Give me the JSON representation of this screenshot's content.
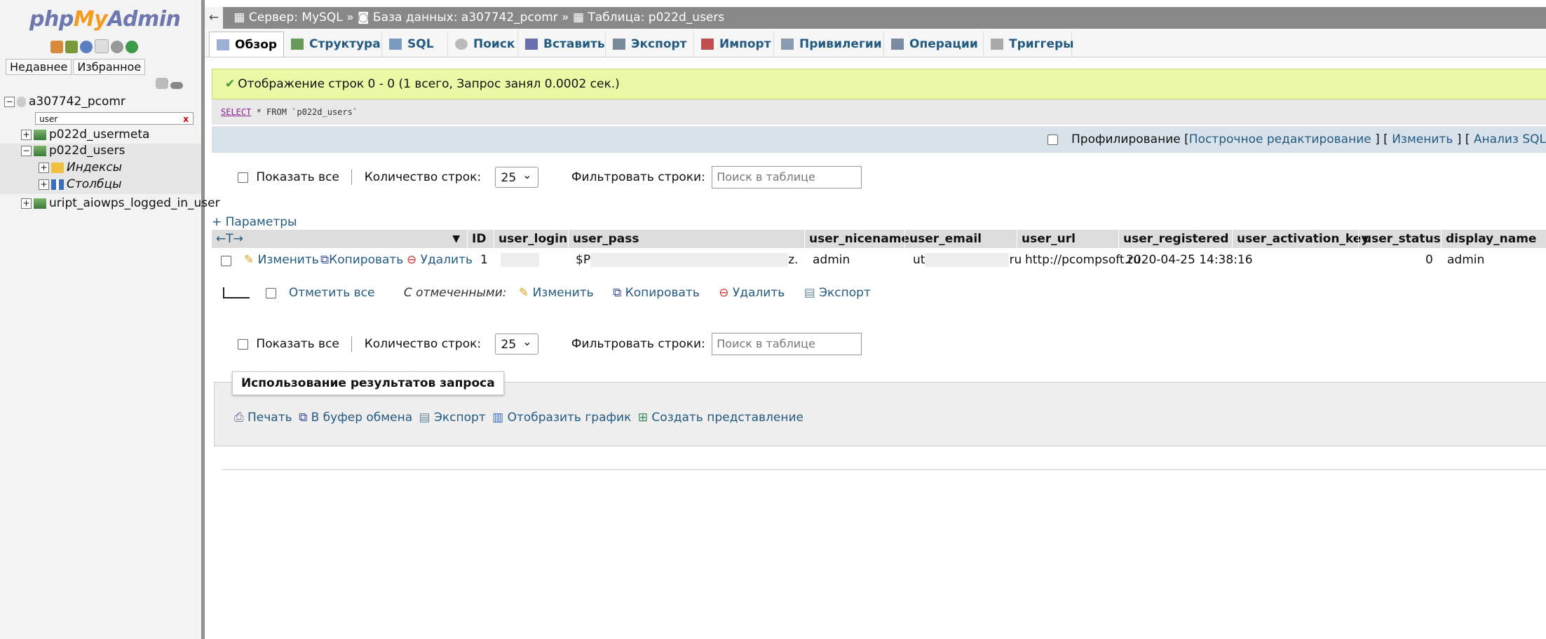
{
  "sidebar": {
    "logo_php": "php",
    "logo_my": "My",
    "logo_admin": "Admin",
    "tabs": [
      "Недавнее",
      "Избранное"
    ],
    "database": "a307742_pcomr",
    "filter_value": "user",
    "filter_clear": "x",
    "tables": [
      {
        "name": "p022d_usermeta"
      },
      {
        "name": "p022d_users"
      },
      {
        "name": "Индексы"
      },
      {
        "name": "Столбцы"
      },
      {
        "name": "uript_aiowps_logged_in_user"
      }
    ]
  },
  "breadcrumb": {
    "back": "←",
    "server": "Сервер: MySQL",
    "sep": "»",
    "database": "База данных: a307742_pcomr",
    "table": "Таблица: p022d_users"
  },
  "tabs": [
    "Обзор",
    "Структура",
    "SQL",
    "Поиск",
    "Вставить",
    "Экспорт",
    "Импорт",
    "Привилегии",
    "Операции",
    "Триггеры"
  ],
  "success_message": "Отображение строк 0 - 0 (1 всего, Запрос занял 0.0002 сек.)",
  "sql": {
    "keyword": "SELECT",
    "rest": " * FROM `p022d_users`"
  },
  "profiling": {
    "label": "Профилирование",
    "open1": "[",
    "inline_edit": "Построчное редактирование",
    "close_open": "] [",
    "edit": "Изменить",
    "close_open2": "] [",
    "analyze": "Анализ SQL"
  },
  "nav": {
    "show_all": "Показать все",
    "rows_label": "Количество строк:",
    "rows_value": "25",
    "filter_label": "Фильтровать строки:",
    "filter_placeholder": "Поиск в таблице"
  },
  "options_link": "+ Параметры",
  "col_arrows": "←T→",
  "columns": [
    "ID",
    "user_login",
    "user_pass",
    "user_nicename",
    "user_email",
    "user_url",
    "user_registered",
    "user_activation_key",
    "user_status",
    "display_name"
  ],
  "row": {
    "edit": "Изменить",
    "copy": "Копировать",
    "delete": "Удалить",
    "id": "1",
    "pass_prefix": "$P",
    "pass_suffix": "z.",
    "nicename": "admin",
    "email_prefix": "ut",
    "email_suffix": "ru",
    "url": "http://pcompsoft.ru",
    "registered": "2020-04-25 14:38:16",
    "status": "0",
    "display_name": "admin"
  },
  "bulk": {
    "check_all": "Отметить все",
    "with_selected": "С отмеченными:",
    "edit": "Изменить",
    "copy": "Копировать",
    "delete": "Удалить",
    "export": "Экспорт"
  },
  "usage": {
    "title": "Использование результатов запроса",
    "print": "Печать",
    "clipboard": "В буфер обмена",
    "export": "Экспорт",
    "chart": "Отобразить график",
    "view": "Создать представление"
  },
  "colors": {
    "link": "#235a81",
    "success_bg": "#ebf8a4",
    "topbar": "#888888"
  }
}
